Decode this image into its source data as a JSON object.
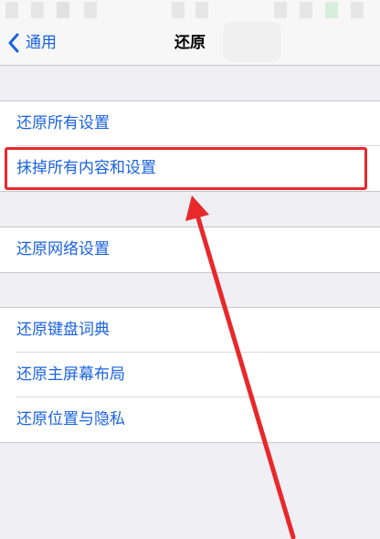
{
  "nav": {
    "back_label": "通用",
    "title": "还原"
  },
  "groups": [
    {
      "items": [
        {
          "label": "还原所有设置"
        },
        {
          "label": "抹掉所有内容和设置"
        }
      ]
    },
    {
      "items": [
        {
          "label": "还原网络设置"
        }
      ]
    },
    {
      "items": [
        {
          "label": "还原键盘词典"
        },
        {
          "label": "还原主屏幕布局"
        },
        {
          "label": "还原位置与隐私"
        }
      ]
    }
  ],
  "annotation": {
    "highlight_color": "#e8282b",
    "highlighted_item": "抹掉所有内容和设置"
  },
  "colors": {
    "accent": "#1a62e0",
    "background": "#efeff4"
  }
}
